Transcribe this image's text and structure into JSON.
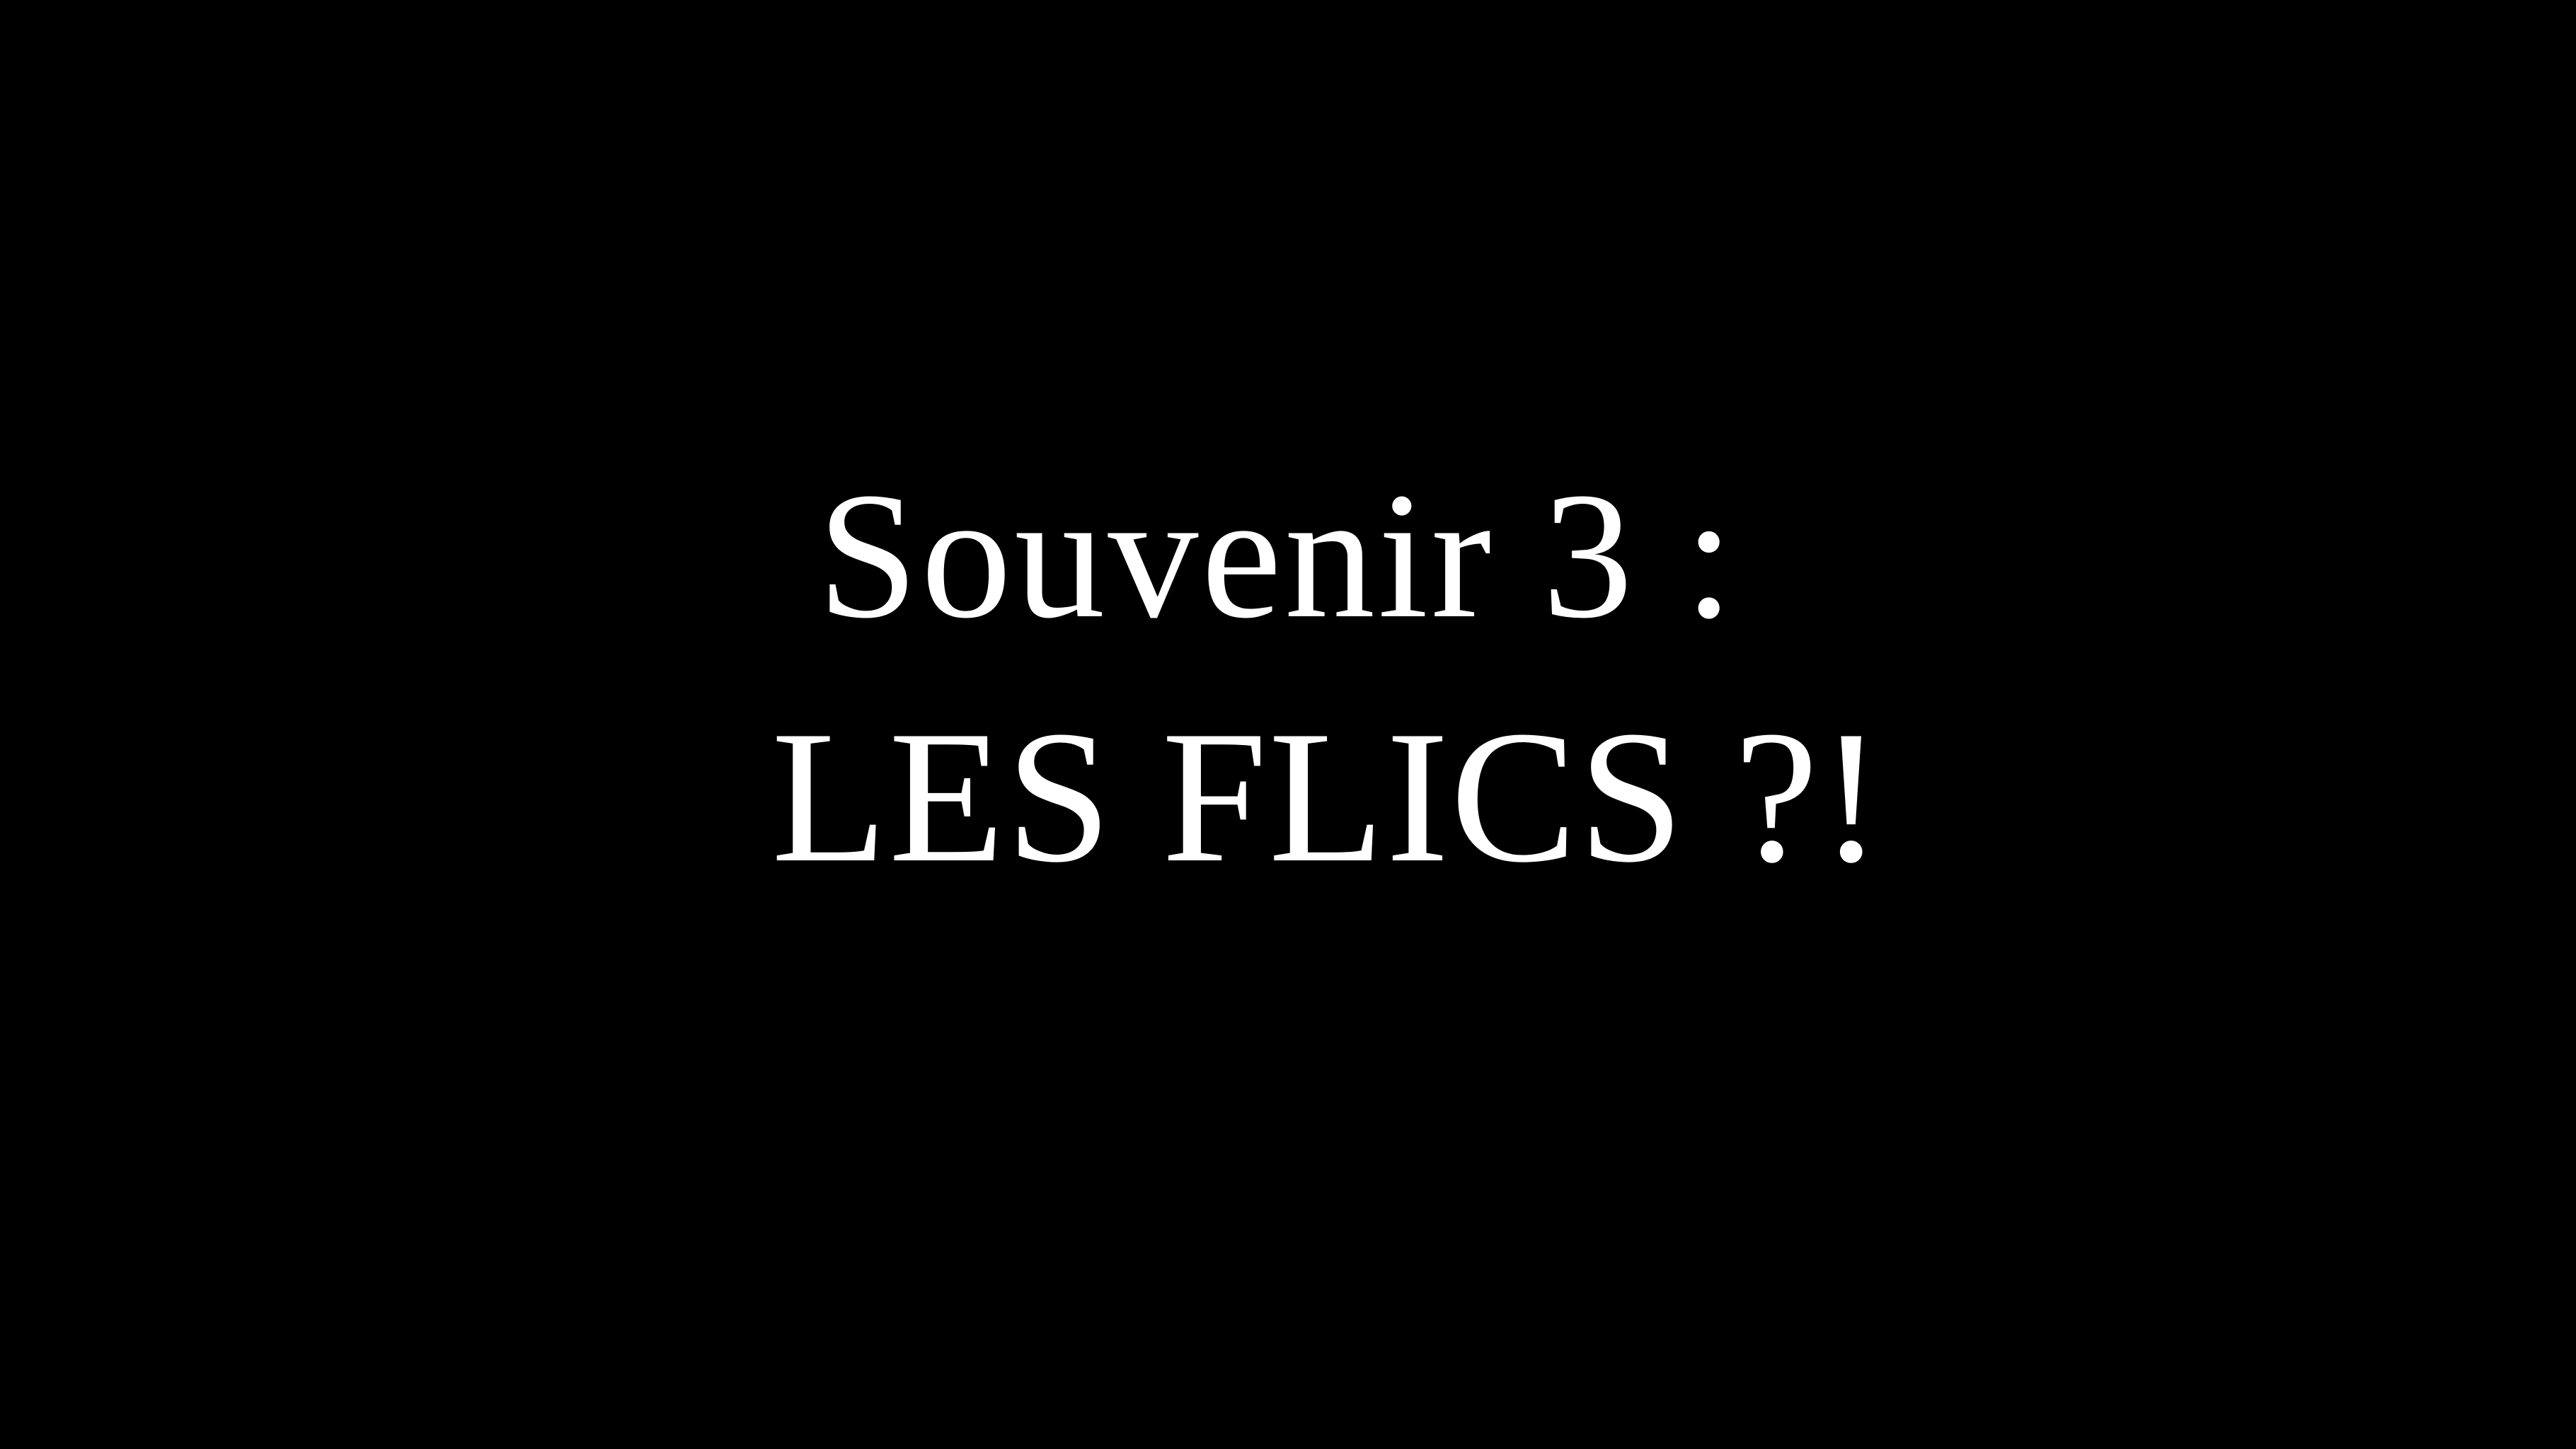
{
  "slide": {
    "line1": "Souvenir 3 :",
    "line2": "LES FLICS ?!",
    "background_color": "#000000",
    "text_color": "#ffffff"
  }
}
